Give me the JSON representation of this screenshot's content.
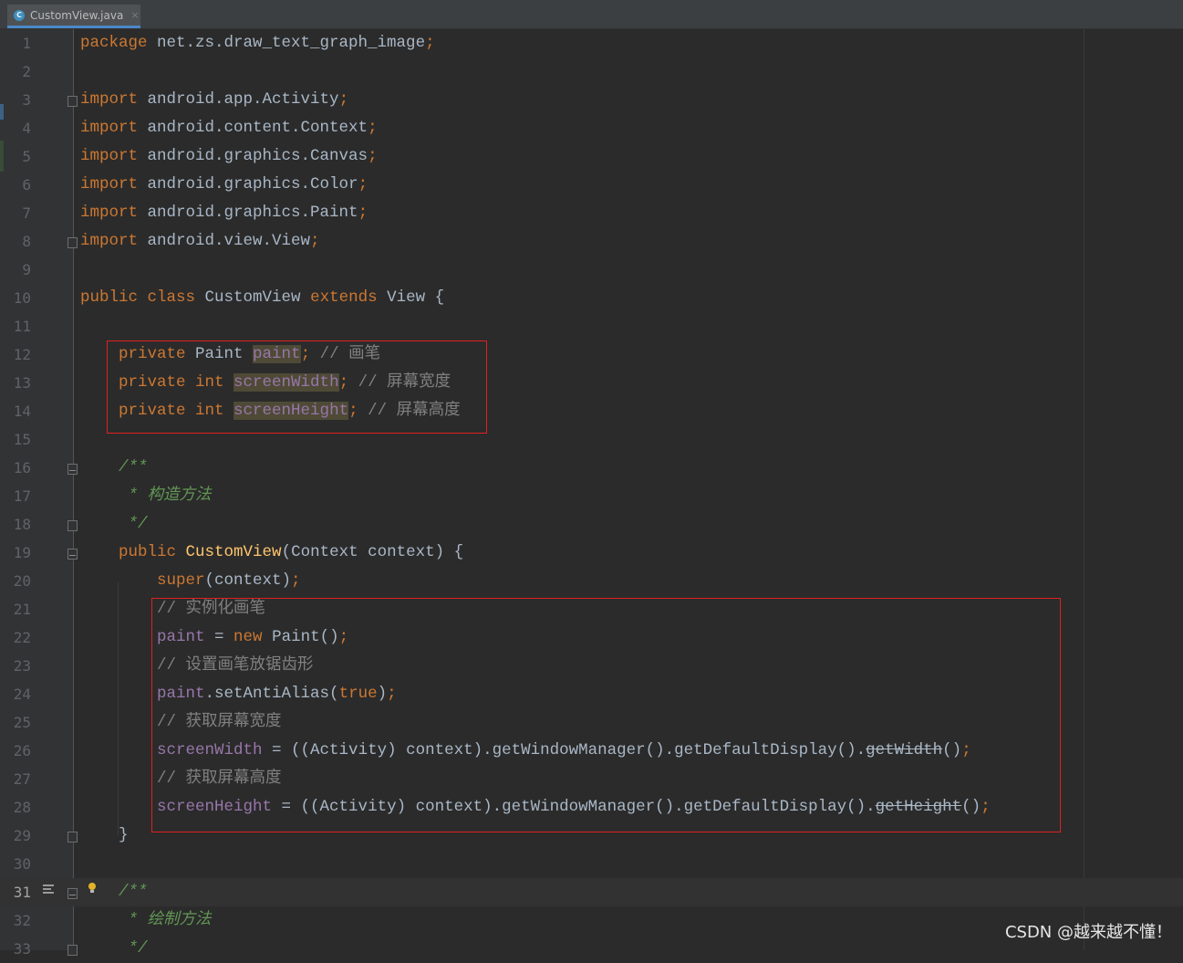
{
  "tab": {
    "icon": "java-class-icon",
    "icon_glyph": "C",
    "filename": "CustomView.java",
    "close": "×"
  },
  "watermark": "CSDN @越来越不懂！",
  "current_line": 31,
  "lines": [
    {
      "n": "1",
      "tokens": [
        [
          "kw",
          "package"
        ],
        [
          "p",
          " net.zs.draw_text_graph_image"
        ],
        [
          "punc",
          ";"
        ]
      ]
    },
    {
      "n": "2",
      "tokens": []
    },
    {
      "n": "3",
      "tokens": [
        [
          "kw",
          "import"
        ],
        [
          "p",
          " android.app.Activity"
        ],
        [
          "punc",
          ";"
        ]
      ]
    },
    {
      "n": "4",
      "tokens": [
        [
          "kw",
          "import"
        ],
        [
          "p",
          " android.content.Context"
        ],
        [
          "punc",
          ";"
        ]
      ]
    },
    {
      "n": "5",
      "tokens": [
        [
          "kw",
          "import"
        ],
        [
          "p",
          " android.graphics.Canvas"
        ],
        [
          "punc",
          ";"
        ]
      ]
    },
    {
      "n": "6",
      "tokens": [
        [
          "kw",
          "import"
        ],
        [
          "p",
          " android.graphics.Color"
        ],
        [
          "punc",
          ";"
        ]
      ]
    },
    {
      "n": "7",
      "tokens": [
        [
          "kw",
          "import"
        ],
        [
          "p",
          " android.graphics.Paint"
        ],
        [
          "punc",
          ";"
        ]
      ]
    },
    {
      "n": "8",
      "tokens": [
        [
          "kw",
          "import"
        ],
        [
          "p",
          " android.view.View"
        ],
        [
          "punc",
          ";"
        ]
      ]
    },
    {
      "n": "9",
      "tokens": []
    },
    {
      "n": "10",
      "tokens": [
        [
          "kw",
          "public class "
        ],
        [
          "p",
          "CustomView "
        ],
        [
          "kw",
          "extends "
        ],
        [
          "p",
          "View {"
        ]
      ]
    },
    {
      "n": "11",
      "tokens": []
    },
    {
      "n": "12",
      "tokens": [
        [
          "p",
          "    "
        ],
        [
          "kw",
          "private "
        ],
        [
          "p",
          "Paint "
        ],
        [
          "fldhl",
          "paint"
        ],
        [
          "punc",
          ";"
        ],
        [
          "cm",
          " // 画笔"
        ]
      ]
    },
    {
      "n": "13",
      "tokens": [
        [
          "p",
          "    "
        ],
        [
          "kw",
          "private int "
        ],
        [
          "fldhl",
          "screenWidth"
        ],
        [
          "punc",
          ";"
        ],
        [
          "cm",
          " // 屏幕宽度"
        ]
      ]
    },
    {
      "n": "14",
      "tokens": [
        [
          "p",
          "    "
        ],
        [
          "kw",
          "private int "
        ],
        [
          "fldhl",
          "screenHeight"
        ],
        [
          "punc",
          ";"
        ],
        [
          "cm",
          " // 屏幕高度"
        ]
      ]
    },
    {
      "n": "15",
      "tokens": []
    },
    {
      "n": "16",
      "tokens": [
        [
          "p",
          "    "
        ],
        [
          "doc",
          "/**"
        ]
      ]
    },
    {
      "n": "17",
      "tokens": [
        [
          "p",
          "    "
        ],
        [
          "doc",
          " * 构造方法"
        ]
      ]
    },
    {
      "n": "18",
      "tokens": [
        [
          "p",
          "    "
        ],
        [
          "doc",
          " */"
        ]
      ]
    },
    {
      "n": "19",
      "tokens": [
        [
          "p",
          "    "
        ],
        [
          "kw",
          "public "
        ],
        [
          "fn",
          "CustomView"
        ],
        [
          "p",
          "(Context context) {"
        ]
      ]
    },
    {
      "n": "20",
      "tokens": [
        [
          "p",
          "        "
        ],
        [
          "kw",
          "super"
        ],
        [
          "p",
          "(context)"
        ],
        [
          "punc",
          ";"
        ]
      ]
    },
    {
      "n": "21",
      "tokens": [
        [
          "p",
          "        "
        ],
        [
          "cm",
          "// 实例化画笔"
        ]
      ]
    },
    {
      "n": "22",
      "tokens": [
        [
          "p",
          "        "
        ],
        [
          "fld",
          "paint"
        ],
        [
          "p",
          " = "
        ],
        [
          "kw",
          "new "
        ],
        [
          "p",
          "Paint()"
        ],
        [
          "punc",
          ";"
        ]
      ]
    },
    {
      "n": "23",
      "tokens": [
        [
          "p",
          "        "
        ],
        [
          "cm",
          "// 设置画笔放锯齿形"
        ]
      ]
    },
    {
      "n": "24",
      "tokens": [
        [
          "p",
          "        "
        ],
        [
          "fld",
          "paint"
        ],
        [
          "p",
          ".setAntiAlias("
        ],
        [
          "kw",
          "true"
        ],
        [
          "p",
          ")"
        ],
        [
          "punc",
          ";"
        ]
      ]
    },
    {
      "n": "25",
      "tokens": [
        [
          "p",
          "        "
        ],
        [
          "cm",
          "// 获取屏幕宽度"
        ]
      ]
    },
    {
      "n": "26",
      "tokens": [
        [
          "p",
          "        "
        ],
        [
          "fld",
          "screenWidth"
        ],
        [
          "p",
          " = ((Activity) context).getWindowManager().getDefaultDisplay()."
        ],
        [
          "strike",
          "getWidth"
        ],
        [
          "p",
          "()"
        ],
        [
          "punc",
          ";"
        ]
      ]
    },
    {
      "n": "27",
      "tokens": [
        [
          "p",
          "        "
        ],
        [
          "cm",
          "// 获取屏幕高度"
        ]
      ]
    },
    {
      "n": "28",
      "tokens": [
        [
          "p",
          "        "
        ],
        [
          "fld",
          "screenHeight"
        ],
        [
          "p",
          " = ((Activity) context).getWindowManager().getDefaultDisplay()."
        ],
        [
          "strike",
          "getHeight"
        ],
        [
          "p",
          "()"
        ],
        [
          "punc",
          ";"
        ]
      ]
    },
    {
      "n": "29",
      "tokens": [
        [
          "p",
          "    }"
        ]
      ]
    },
    {
      "n": "30",
      "tokens": []
    },
    {
      "n": "31",
      "tokens": [
        [
          "p",
          "    "
        ],
        [
          "doc",
          "/**"
        ]
      ]
    },
    {
      "n": "32",
      "tokens": [
        [
          "p",
          "    "
        ],
        [
          "doc",
          " * 绘制方法"
        ]
      ]
    },
    {
      "n": "33",
      "tokens": [
        [
          "p",
          "    "
        ],
        [
          "doc",
          " */"
        ]
      ]
    }
  ],
  "colors": {
    "background": "#2b2b2b",
    "gutter": "#313335",
    "keyword": "#cc7832",
    "field": "#9876aa",
    "method_decl": "#ffc66d",
    "comment": "#808080",
    "javadoc": "#629755",
    "plain": "#a9b7c6",
    "highlight_box": "#e02020"
  }
}
